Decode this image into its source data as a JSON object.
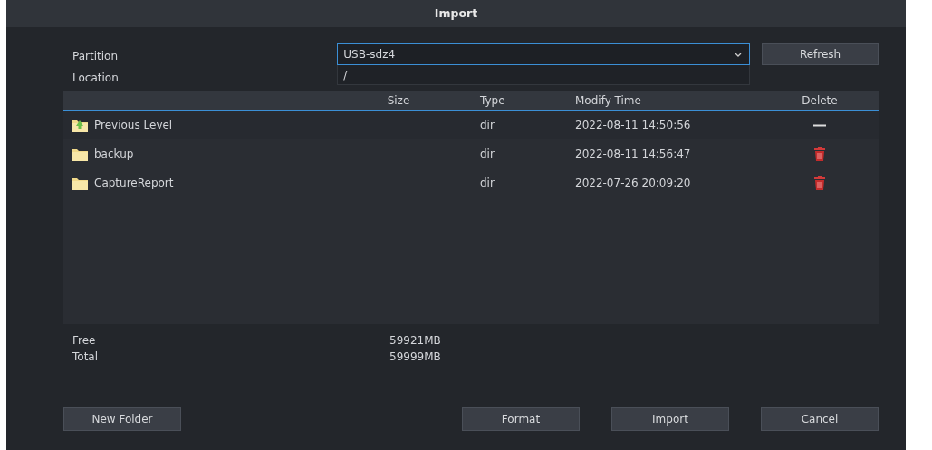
{
  "window": {
    "title": "Import"
  },
  "partition": {
    "label": "Partition",
    "value": "USB-sdz4"
  },
  "location": {
    "label": "Location",
    "value": "/"
  },
  "refresh_button": "Refresh",
  "table": {
    "columns": [
      "Size",
      "Type",
      "Modify Time",
      "Delete"
    ],
    "rows": [
      {
        "kind": "parent",
        "name": "Previous Level",
        "type": "dir",
        "modified": "2022-08-11 14:50:56",
        "selected": true
      },
      {
        "kind": "folder",
        "name": "backup",
        "type": "dir",
        "modified": "2022-08-11 14:56:47",
        "selected": false
      },
      {
        "kind": "folder",
        "name": "CaptureReport",
        "type": "dir",
        "modified": "2022-07-26 20:09:20",
        "selected": false
      }
    ]
  },
  "stats": [
    {
      "label": "Free",
      "value": "59921MB"
    },
    {
      "label": "Total",
      "value": "59999MB"
    }
  ],
  "buttons": {
    "left": [
      "New Folder"
    ],
    "right": [
      "Format",
      "Import",
      "Cancel"
    ]
  }
}
